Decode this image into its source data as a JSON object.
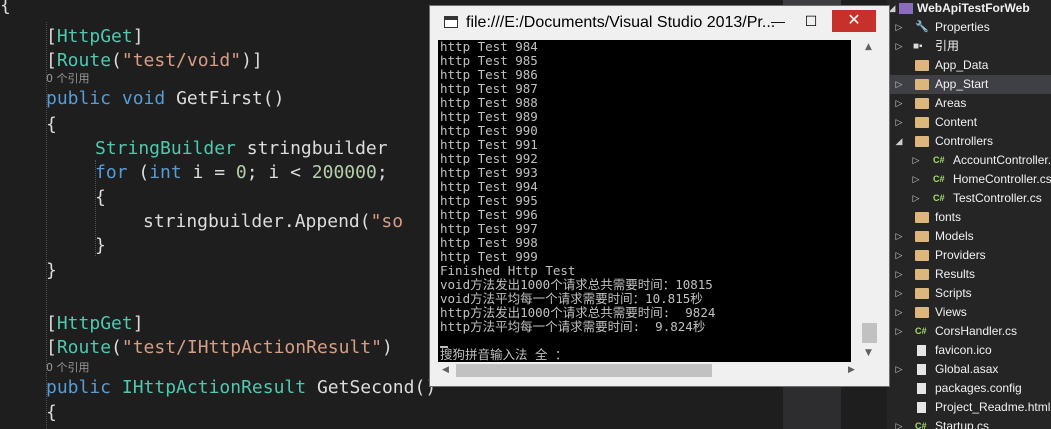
{
  "editor": {
    "lines": {
      "l0": "{",
      "l1_a": "[",
      "l1_b": "HttpGet",
      "l1_c": "]",
      "l2_a": "[",
      "l2_b": "Route",
      "l2_c": "(",
      "l2_d": "\"test/void\"",
      "l2_e": ")]",
      "ref1": "0 个引用",
      "l3_a": "public",
      "l3_b": "void",
      "l3_c": " GetFirst()",
      "l4": "{",
      "l5_a": "StringBuilder",
      "l5_b": " stringbuilder",
      "l6_a": "for",
      "l6_b": " (",
      "l6_c": "int",
      "l6_d": " i = ",
      "l6_e": "0",
      "l6_f": "; i < ",
      "l6_g": "200000",
      "l6_h": ";",
      "l7": "{",
      "l8_a": "stringbuilder.Append(",
      "l8_b": "\"so",
      "l9": "}",
      "l10": "}",
      "l11_a": "[",
      "l11_b": "HttpGet",
      "l11_c": "]",
      "l12_a": "[",
      "l12_b": "Route",
      "l12_c": "(",
      "l12_d": "\"test/IHttpActionResult\"",
      "l12_e": ")",
      "ref2": "0 个引用",
      "l13_a": "public",
      "l13_b": " IHttpActionResult",
      "l13_c": " GetSecond()",
      "l14": "{"
    }
  },
  "console": {
    "title": "file:///E:/Documents/Visual Studio 2013/Pr...",
    "minimize": "—",
    "maximize": "☐",
    "close": "✕",
    "output": [
      "http Test 984",
      "http Test 985",
      "http Test 986",
      "http Test 987",
      "http Test 988",
      "http Test 989",
      "http Test 990",
      "http Test 991",
      "http Test 992",
      "http Test 993",
      "http Test 994",
      "http Test 995",
      "http Test 996",
      "http Test 997",
      "http Test 998",
      "http Test 999",
      "Finished Http Test",
      "void方法发出1000个请求总共需要时间：10815",
      "void方法平均每一个请求需要时间：10.815秒",
      "http方法发出1000个请求总共需要时间:  9824",
      "http方法平均每一个请求需要时间:  9.824秒",
      "",
      "搜狗拼音输入法 全 ："
    ]
  },
  "solution": {
    "items": [
      {
        "label": "WebApiTestForWeb",
        "type": "project"
      },
      {
        "label": "Properties",
        "type": "wrench"
      },
      {
        "label": "引用",
        "type": "refs"
      },
      {
        "label": "App_Data",
        "type": "folder"
      },
      {
        "label": "App_Start",
        "type": "folder"
      },
      {
        "label": "Areas",
        "type": "folder"
      },
      {
        "label": "Content",
        "type": "folder"
      },
      {
        "label": "Controllers",
        "type": "folder"
      },
      {
        "label": "AccountController.cs",
        "type": "cs"
      },
      {
        "label": "HomeController.cs",
        "type": "cs"
      },
      {
        "label": "TestController.cs",
        "type": "cs"
      },
      {
        "label": "fonts",
        "type": "folder"
      },
      {
        "label": "Models",
        "type": "folder"
      },
      {
        "label": "Providers",
        "type": "folder"
      },
      {
        "label": "Results",
        "type": "folder"
      },
      {
        "label": "Scripts",
        "type": "folder"
      },
      {
        "label": "Views",
        "type": "folder"
      },
      {
        "label": "CorsHandler.cs",
        "type": "cs"
      },
      {
        "label": "favicon.ico",
        "type": "file"
      },
      {
        "label": "Global.asax",
        "type": "file"
      },
      {
        "label": "packages.config",
        "type": "file"
      },
      {
        "label": "Project_Readme.html",
        "type": "file"
      },
      {
        "label": "Startup.cs",
        "type": "cs"
      }
    ]
  }
}
